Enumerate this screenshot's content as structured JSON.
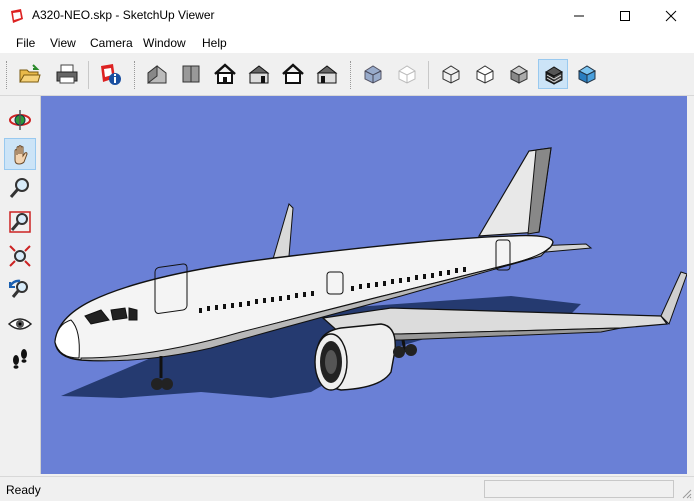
{
  "window": {
    "title": "A320-NEO.skp - SketchUp Viewer",
    "app_icon": "sketchup-icon",
    "controls": [
      "minimize-icon",
      "maximize-icon",
      "close-icon"
    ]
  },
  "menu": {
    "file": "File",
    "view": "View",
    "camera": "Camera",
    "window": "Window",
    "help": "Help"
  },
  "toolbar": {
    "file_tools": [
      "open-icon",
      "print-icon",
      "model-info-icon"
    ],
    "view_tools": [
      "iso-view-icon",
      "top-view-icon",
      "front-view-icon",
      "right-view-icon",
      "back-view-icon",
      "left-view-icon"
    ],
    "style_tools": [
      "xray-icon",
      "back-edges-icon",
      "wireframe-icon",
      "hidden-line-icon",
      "shaded-icon",
      "shaded-textures-icon",
      "monochrome-icon"
    ],
    "active_style": "shaded-textures-icon"
  },
  "camera_tools": {
    "items": [
      "orbit-icon",
      "pan-icon",
      "zoom-icon",
      "zoom-window-icon",
      "zoom-extents-icon",
      "previous-view-icon",
      "look-around-icon",
      "walk-icon"
    ],
    "active": "pan-icon"
  },
  "viewport": {
    "background_color": "#6a80d6",
    "model": "airplane-model"
  },
  "status": {
    "text": "Ready"
  }
}
